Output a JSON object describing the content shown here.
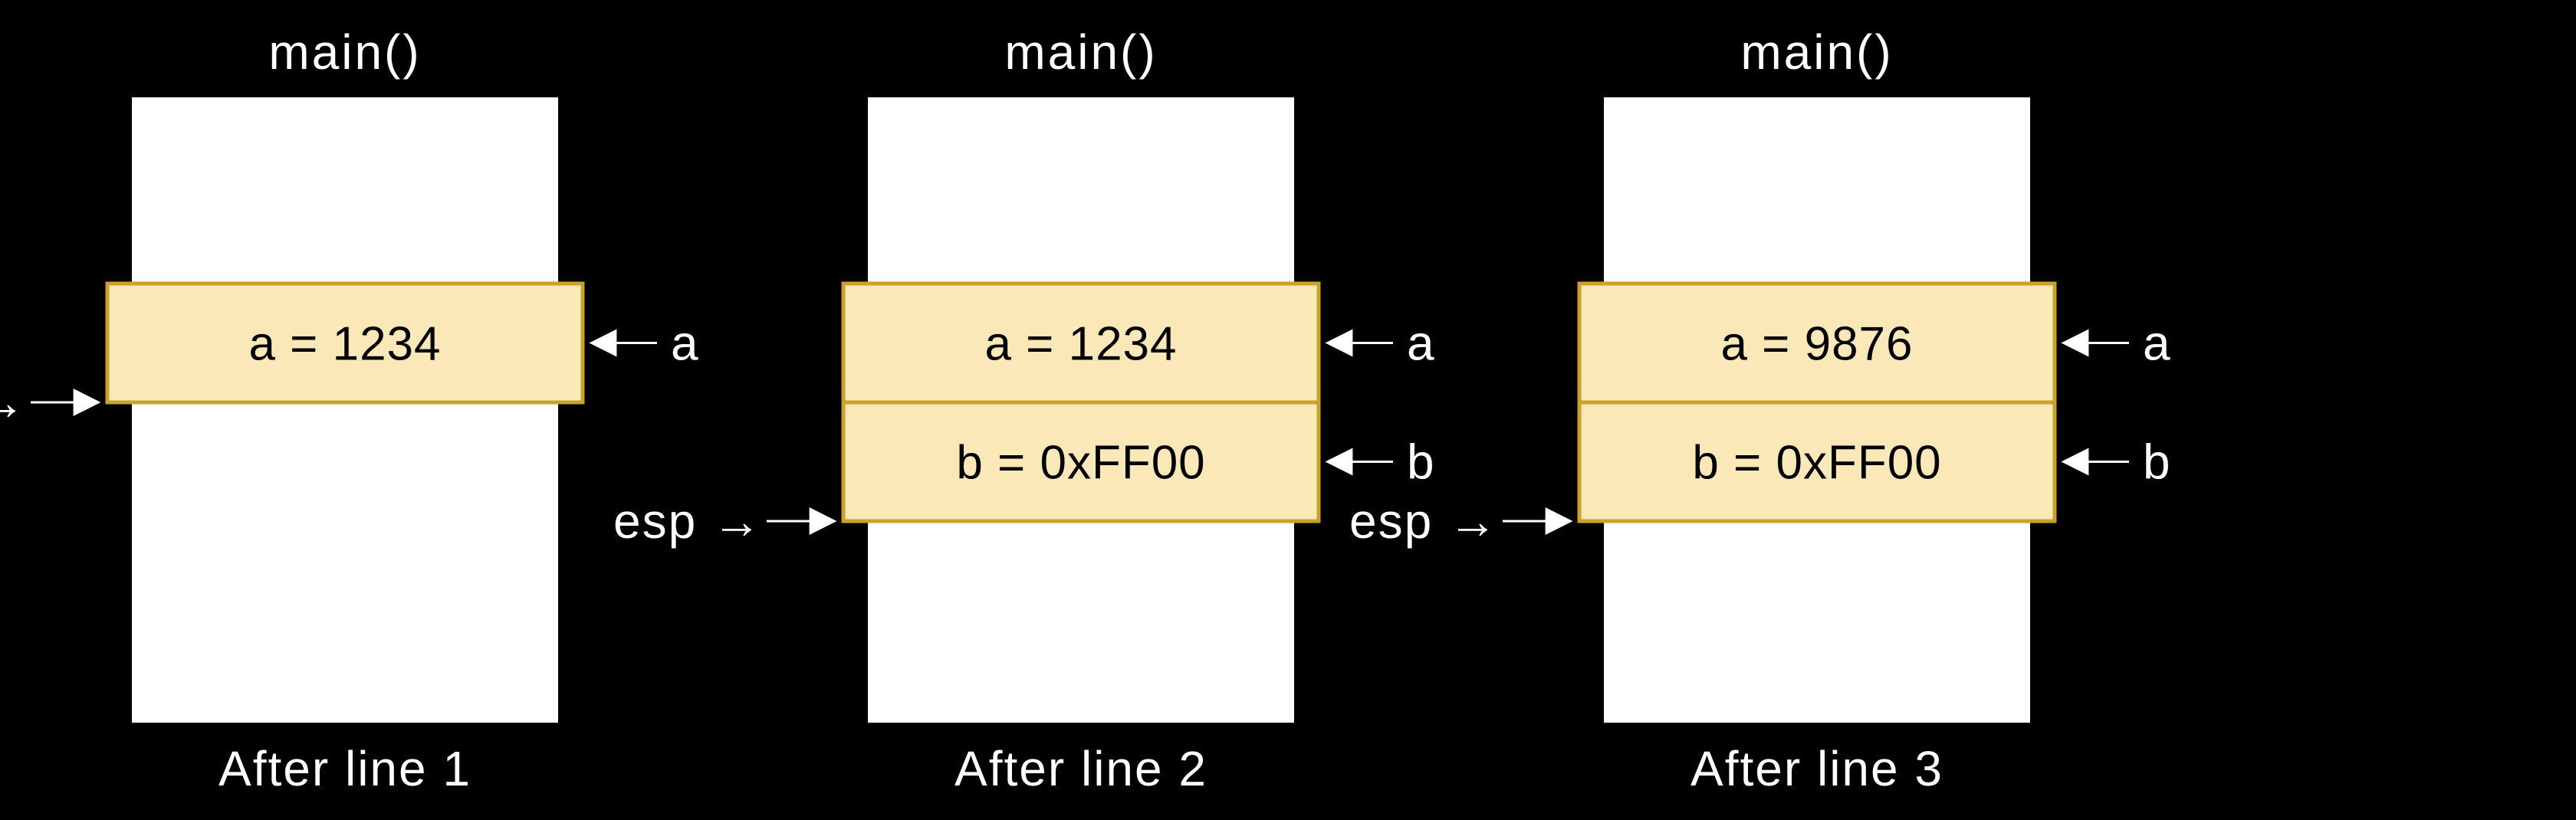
{
  "global": {
    "top_label": "main()",
    "side_label_esp": "esp →",
    "side_label_a": "a",
    "side_label_b": "b",
    "bottom_label_prefix": "After line "
  },
  "panels": [
    {
      "line_no": "1",
      "cells": [
        {
          "name": "a",
          "text": "a = 1234"
        }
      ]
    },
    {
      "line_no": "2",
      "cells": [
        {
          "name": "a",
          "text": "a = 1234"
        },
        {
          "name": "b",
          "text": "b = 0xFF00"
        }
      ]
    },
    {
      "line_no": "3",
      "cells": [
        {
          "name": "a",
          "text": "a = 9876"
        },
        {
          "name": "b",
          "text": "b = 0xFF00"
        }
      ]
    }
  ]
}
